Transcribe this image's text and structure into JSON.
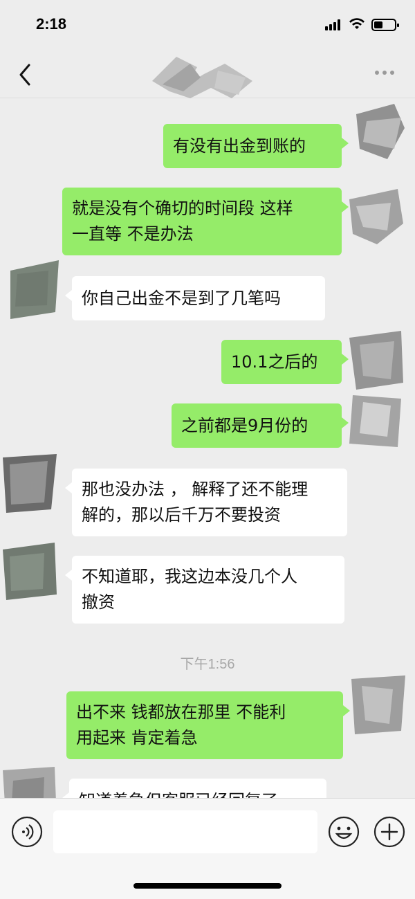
{
  "status": {
    "time": "2:18",
    "battery_level": 0.35
  },
  "nav": {
    "back_icon": "chevron-left-icon",
    "more_icon": "more-dots-icon",
    "title_obscured": true
  },
  "messages": [
    {
      "side": "mine",
      "lines": [
        "有没有出金到账的"
      ]
    },
    {
      "side": "mine",
      "lines": [
        "就是没有个确切的时间段 这样",
        "一直等 不是办法"
      ]
    },
    {
      "side": "theirs",
      "lines": [
        "你自己出金不是到了几笔吗"
      ]
    },
    {
      "side": "mine",
      "lines": [
        "10.1之后的"
      ]
    },
    {
      "side": "mine",
      "lines": [
        "之前都是9月份的"
      ]
    },
    {
      "side": "theirs",
      "lines": [
        "那也没办法 ， 解释了还不能理",
        "解的，那以后千万不要投资"
      ]
    },
    {
      "side": "theirs",
      "lines": [
        "不知道耶，我这边本没几个人",
        "撤资"
      ]
    },
    {
      "side": "mine",
      "lines": [
        "出不来 钱都放在那里   不能利",
        "用起来 肯定着急"
      ]
    },
    {
      "side": "theirs",
      "lines": [
        "知道着急但客服已经回复了"
      ]
    }
  ],
  "timestamp": "下午1:56",
  "input": {
    "value": "",
    "voice_icon": "voice-icon",
    "emoji_icon": "emoji-icon",
    "plus_icon": "plus-icon"
  },
  "colors": {
    "mine_bubble": "#95ec69",
    "theirs_bubble": "#ffffff",
    "background": "#ededed"
  }
}
